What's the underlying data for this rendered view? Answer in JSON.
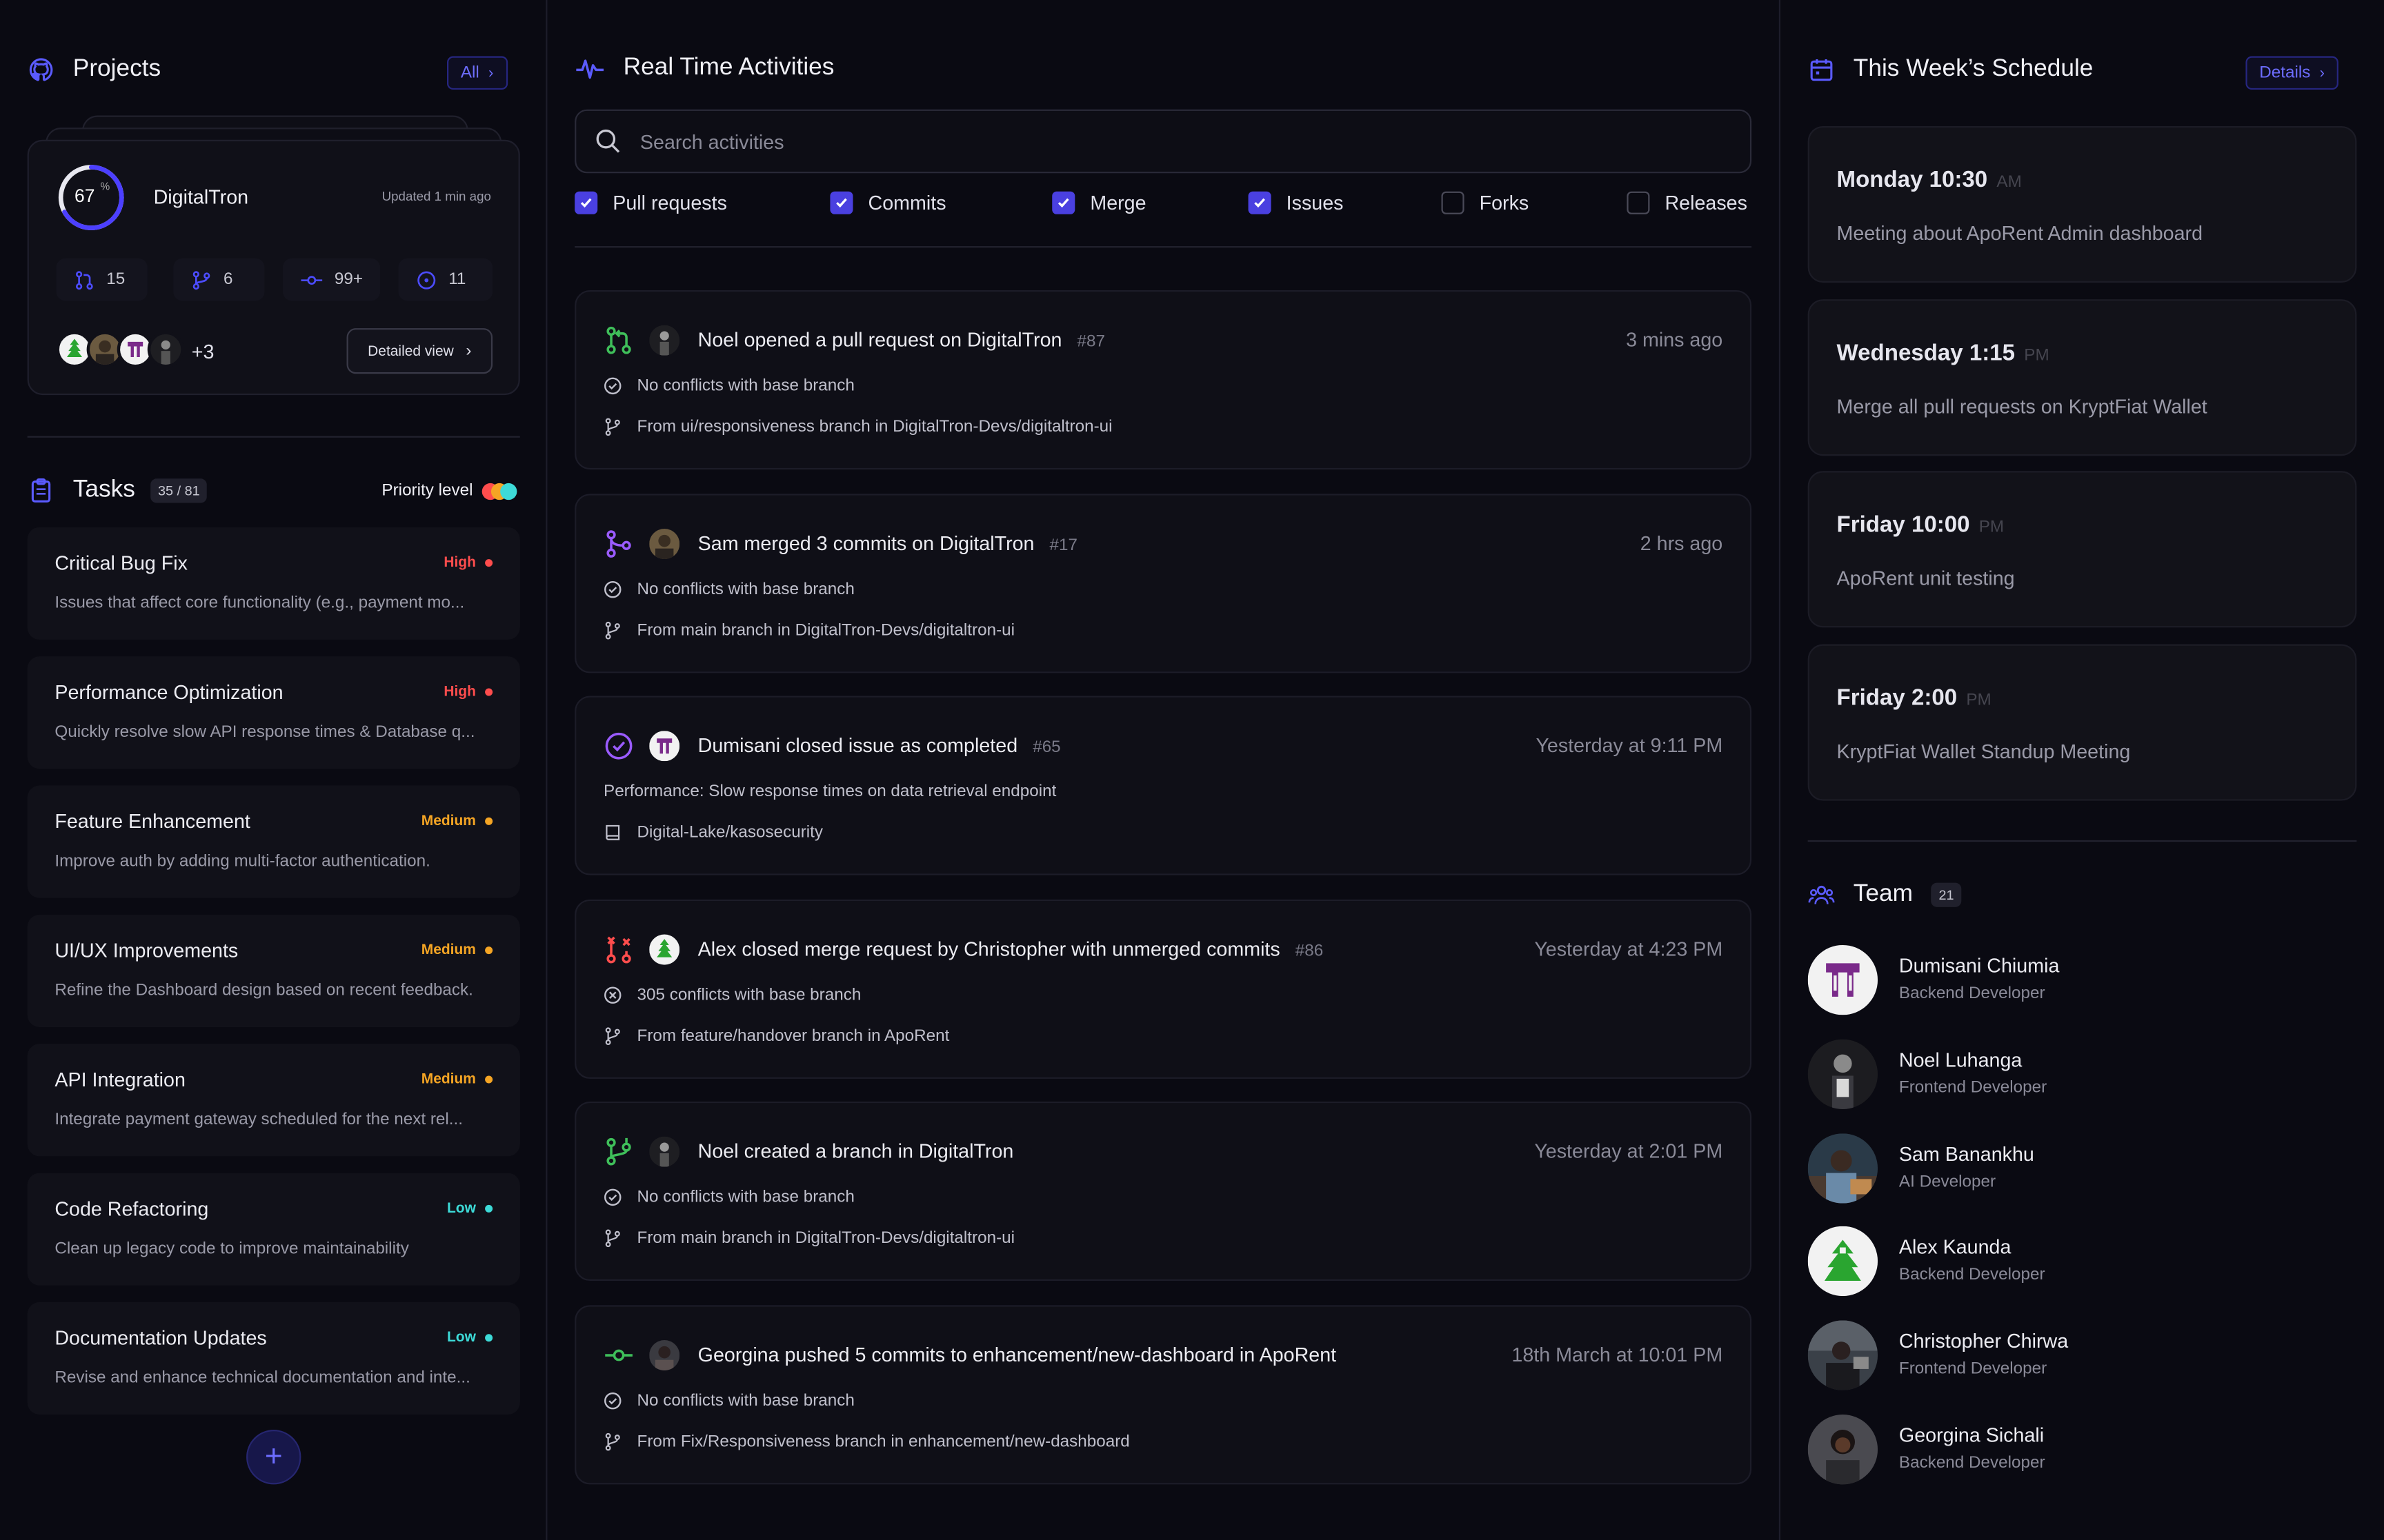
{
  "projects": {
    "title": "Projects",
    "all_label": "All",
    "card": {
      "progress_pct": 67,
      "progress_label": "67",
      "percent_sign": "%",
      "name": "DigitalTron",
      "updated": "Updated 1 min ago",
      "stats": [
        {
          "icon": "pull-request-icon",
          "value": "15"
        },
        {
          "icon": "branch-icon",
          "value": "6"
        },
        {
          "icon": "commit-icon",
          "value": "99+"
        },
        {
          "icon": "issue-icon",
          "value": "11"
        }
      ],
      "extra_members": "+3",
      "detailed_view_label": "Detailed view"
    }
  },
  "tasks": {
    "title": "Tasks",
    "count": "35 / 81",
    "priority_label": "Priority level",
    "items": [
      {
        "name": "Critical Bug Fix",
        "priority": "High",
        "desc": "Issues that affect core functionality (e.g., payment mo..."
      },
      {
        "name": "Performance Optimization",
        "priority": "High",
        "desc": "Quickly resolve slow API response times & Database q..."
      },
      {
        "name": "Feature Enhancement",
        "priority": "Medium",
        "desc": "Improve auth by adding multi-factor authentication."
      },
      {
        "name": "UI/UX Improvements",
        "priority": "Medium",
        "desc": "Refine the Dashboard design based on recent feedback."
      },
      {
        "name": "API Integration",
        "priority": "Medium",
        "desc": "Integrate payment gateway scheduled for the next rel..."
      },
      {
        "name": "Code Refactoring",
        "priority": "Low",
        "desc": "Clean up legacy code to improve maintainability"
      },
      {
        "name": "Documentation Updates",
        "priority": "Low",
        "desc": "Revise and enhance technical documentation and inte..."
      }
    ],
    "colors": {
      "High": "#ff4d4d",
      "Medium": "#f5a524",
      "Low": "#3ddad7"
    }
  },
  "activities": {
    "title": "Real Time Activities",
    "search_placeholder": "Search activities",
    "filters": [
      {
        "label": "Pull requests",
        "checked": true
      },
      {
        "label": "Commits",
        "checked": true
      },
      {
        "label": "Merge",
        "checked": true
      },
      {
        "label": "Issues",
        "checked": true
      },
      {
        "label": "Forks",
        "checked": false
      },
      {
        "label": "Releases",
        "checked": false
      }
    ],
    "items": [
      {
        "icon": "pull-request-icon",
        "title": "Noel  opened a pull request on DigitalTron",
        "num": "#87",
        "time": "3 mins ago",
        "line1": "No conflicts with base branch",
        "line2": "From ui/responsiveness branch in DigitalTron-Devs/digitaltron-ui"
      },
      {
        "icon": "merge-icon",
        "title": "Sam merged 3 commits on  DigitalTron",
        "num": "#17",
        "time": "2 hrs ago",
        "line1": "No conflicts with base branch",
        "line2": "From main  branch in  DigitalTron-Devs/digitaltron-ui"
      },
      {
        "icon": "issue-closed-icon",
        "title": "Dumisani closed issue as completed",
        "num": "#65",
        "time": "Yesterday at 9:11 PM",
        "line1": "Performance: Slow response times on data retrieval endpoint",
        "line2": "Digital-Lake/kasosecurity"
      },
      {
        "icon": "merge-closed-icon",
        "title": "Alex closed merge request by Christopher  with unmerged commits",
        "num": "#86",
        "time": "Yesterday at 4:23 PM",
        "line1": "305 conflicts with base branch",
        "line2": "From feature/handover branch in ApoRent"
      },
      {
        "icon": "branch-created-icon",
        "title": "Noel  created a branch in DigitalTron",
        "num": "",
        "time": "Yesterday at 2:01 PM",
        "line1": "No conflicts with base branch",
        "line2": "From main  branch in  DigitalTron-Devs/digitaltron-ui"
      },
      {
        "icon": "commit-icon",
        "title": "Georgina pushed 5 commits to enhancement/new-dashboard in ApoRent",
        "num": "",
        "time": "18th March  at 10:01 PM",
        "line1": "No conflicts with base branch",
        "line2": "From Fix/Responsiveness branch in enhancement/new-dashboard"
      }
    ]
  },
  "schedule": {
    "title": "This Week’s Schedule",
    "details_label": "Details",
    "items": [
      {
        "day": "Monday 10:30",
        "ampm": "AM",
        "text": "Meeting about ApoRent Admin dashboard"
      },
      {
        "day": "Wednesday 1:15",
        "ampm": "PM",
        "text": "Merge all pull requests on KryptFiat Wallet"
      },
      {
        "day": "Friday 10:00",
        "ampm": "PM",
        "text": "ApoRent unit testing"
      },
      {
        "day": "Friday 2:00",
        "ampm": "PM",
        "text": "KryptFiat Wallet Standup Meeting"
      }
    ]
  },
  "team": {
    "title": "Team",
    "count": "21",
    "members": [
      {
        "name": "Dumisani Chiumia",
        "role": "Backend Developer"
      },
      {
        "name": "Noel Luhanga",
        "role": "Frontend Developer"
      },
      {
        "name": "Sam Banankhu",
        "role": "AI Developer"
      },
      {
        "name": "Alex Kaunda",
        "role": "Backend Developer"
      },
      {
        "name": "Christopher Chirwa",
        "role": "Frontend Developer"
      },
      {
        "name": "Georgina Sichali",
        "role": "Backend Developer"
      }
    ]
  }
}
